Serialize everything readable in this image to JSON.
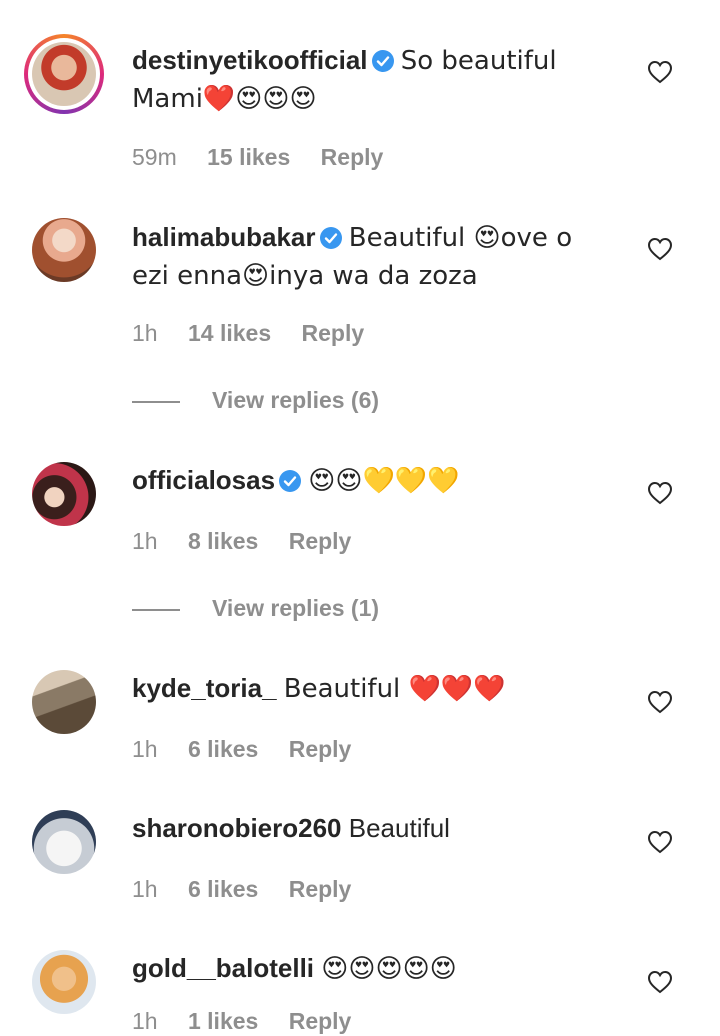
{
  "labels": {
    "reply": "Reply"
  },
  "comments": [
    {
      "username": "destinyetikoofficial",
      "verified": true,
      "text": "So beautiful Mami❤️😍😍😍",
      "time": "59m",
      "likes": "15 likes",
      "story_ring": true
    },
    {
      "username": "halimabubakar",
      "verified": true,
      "text": "Beautiful 😍ove o ezi enna😍inya wa da zoza",
      "time": "1h",
      "likes": "14 likes",
      "view_replies": "View replies (6)"
    },
    {
      "username": "officialosas",
      "verified": true,
      "text": "😍😍💛💛💛",
      "time": "1h",
      "likes": "8 likes",
      "view_replies": "View replies (1)"
    },
    {
      "username": "kyde_toria_",
      "verified": false,
      "text": "Beautiful ❤️❤️❤️",
      "time": "1h",
      "likes": "6 likes"
    },
    {
      "username": "sharonobiero260",
      "verified": false,
      "text": "Beautiful",
      "time": "1h",
      "likes": "6 likes"
    },
    {
      "username": "gold__balotelli",
      "verified": false,
      "text": "😍😍😍😍😍",
      "time": "1h",
      "likes": "1 likes"
    }
  ],
  "icons": {
    "heart": "heart-outline-icon",
    "verified": "verified-badge-icon"
  },
  "colors": {
    "text": "#262626",
    "muted": "#8e8e8e",
    "verified": "#3897f0"
  }
}
